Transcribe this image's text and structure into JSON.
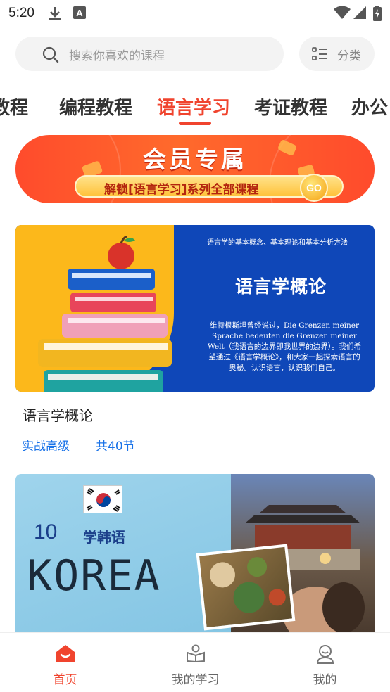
{
  "status_bar": {
    "time": "5:20",
    "icons": [
      "download-icon",
      "a-icon",
      "wifi-icon",
      "signal-icon",
      "battery-icon"
    ]
  },
  "search": {
    "placeholder": "搜索你喜欢的课程",
    "category_label": "分类"
  },
  "tabs": [
    {
      "label": "教程",
      "active": false
    },
    {
      "label": "编程教程",
      "active": false
    },
    {
      "label": "语言学习",
      "active": true
    },
    {
      "label": "考证教程",
      "active": false
    },
    {
      "label": "办公",
      "active": false
    }
  ],
  "banner": {
    "title": "会员专属",
    "subtitle": "解锁[语言学习]系列全部课程",
    "go": "GO"
  },
  "courses": [
    {
      "image": {
        "heading": "语言学的基本概念、基本理论和基本分析方法",
        "title": "语言学概论",
        "body": "维特根斯坦曾经说过，Die Grenzen meiner Sprache bedeuten die Grenzen meiner Welt（我语言的边界即我世界的边界）。我们希望通过《语言学概论》，和大家一起探索语言的奥秘。认识语言，认识我们自己。"
      },
      "name": "语言学概论",
      "level": "实战高级",
      "lessons": "共40节"
    },
    {
      "image": {
        "number": "10",
        "subtitle": "学韩语",
        "title": "KOREA"
      }
    }
  ],
  "bottom_nav": [
    {
      "label": "首页",
      "icon": "home-icon",
      "active": true
    },
    {
      "label": "我的学习",
      "icon": "study-icon",
      "active": false
    },
    {
      "label": "我的",
      "icon": "profile-icon",
      "active": false
    }
  ],
  "colors": {
    "accent": "#f0442e",
    "link_blue": "#1a73e8",
    "card_blue": "#0f47b8",
    "card_yellow": "#fcb81b"
  }
}
